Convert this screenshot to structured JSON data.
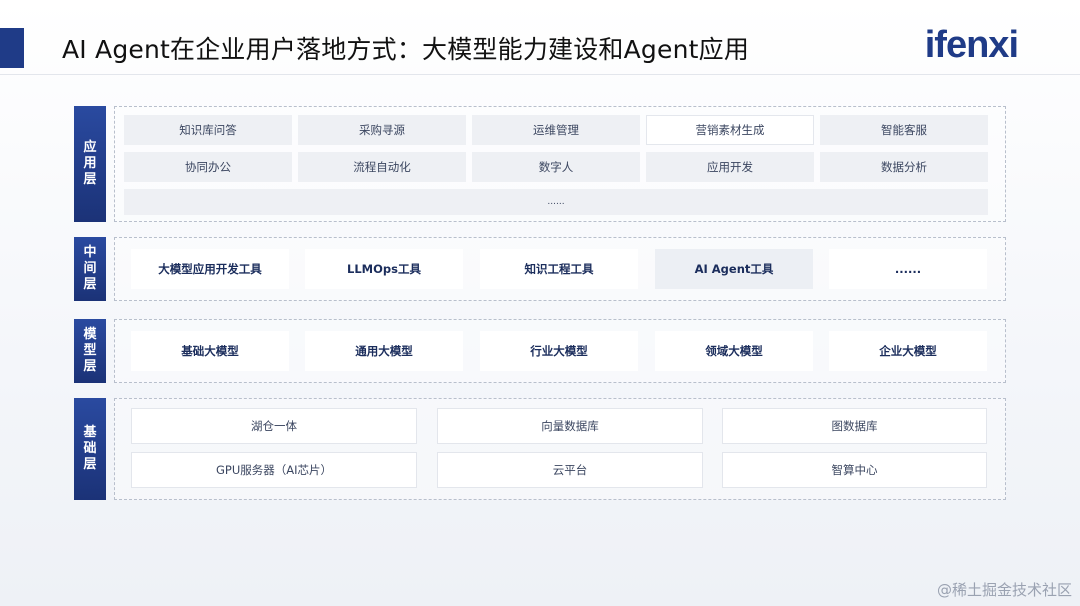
{
  "header": {
    "title": "AI Agent在企业用户落地方式：大模型能力建设和Agent应用",
    "logo": "ifenxi"
  },
  "layers": {
    "application": {
      "label": [
        "应",
        "用",
        "层"
      ],
      "rows": [
        [
          "知识库问答",
          "采购寻源",
          "运维管理",
          "营销素材生成",
          "智能客服"
        ],
        [
          "协同办公",
          "流程自动化",
          "数字人",
          "应用开发",
          "数据分析"
        ]
      ],
      "more": "......"
    },
    "middle": {
      "label": [
        "中",
        "间",
        "层"
      ],
      "items": [
        "大模型应用开发工具",
        "LLMOps工具",
        "知识工程工具",
        "AI Agent工具",
        "......"
      ]
    },
    "model": {
      "label": [
        "模",
        "型",
        "层"
      ],
      "items": [
        "基础大模型",
        "通用大模型",
        "行业大模型",
        "领域大模型",
        "企业大模型"
      ]
    },
    "base": {
      "label": [
        "基",
        "础",
        "层"
      ],
      "rows": [
        [
          "湖仓一体",
          "向量数据库",
          "图数据库"
        ],
        [
          "GPU服务器（AI芯片）",
          "云平台",
          "智算中心"
        ]
      ]
    }
  },
  "watermark": "@稀土掘金技术社区",
  "colors": {
    "accent": "#1f3b87",
    "label_bg": "#223d8f"
  }
}
